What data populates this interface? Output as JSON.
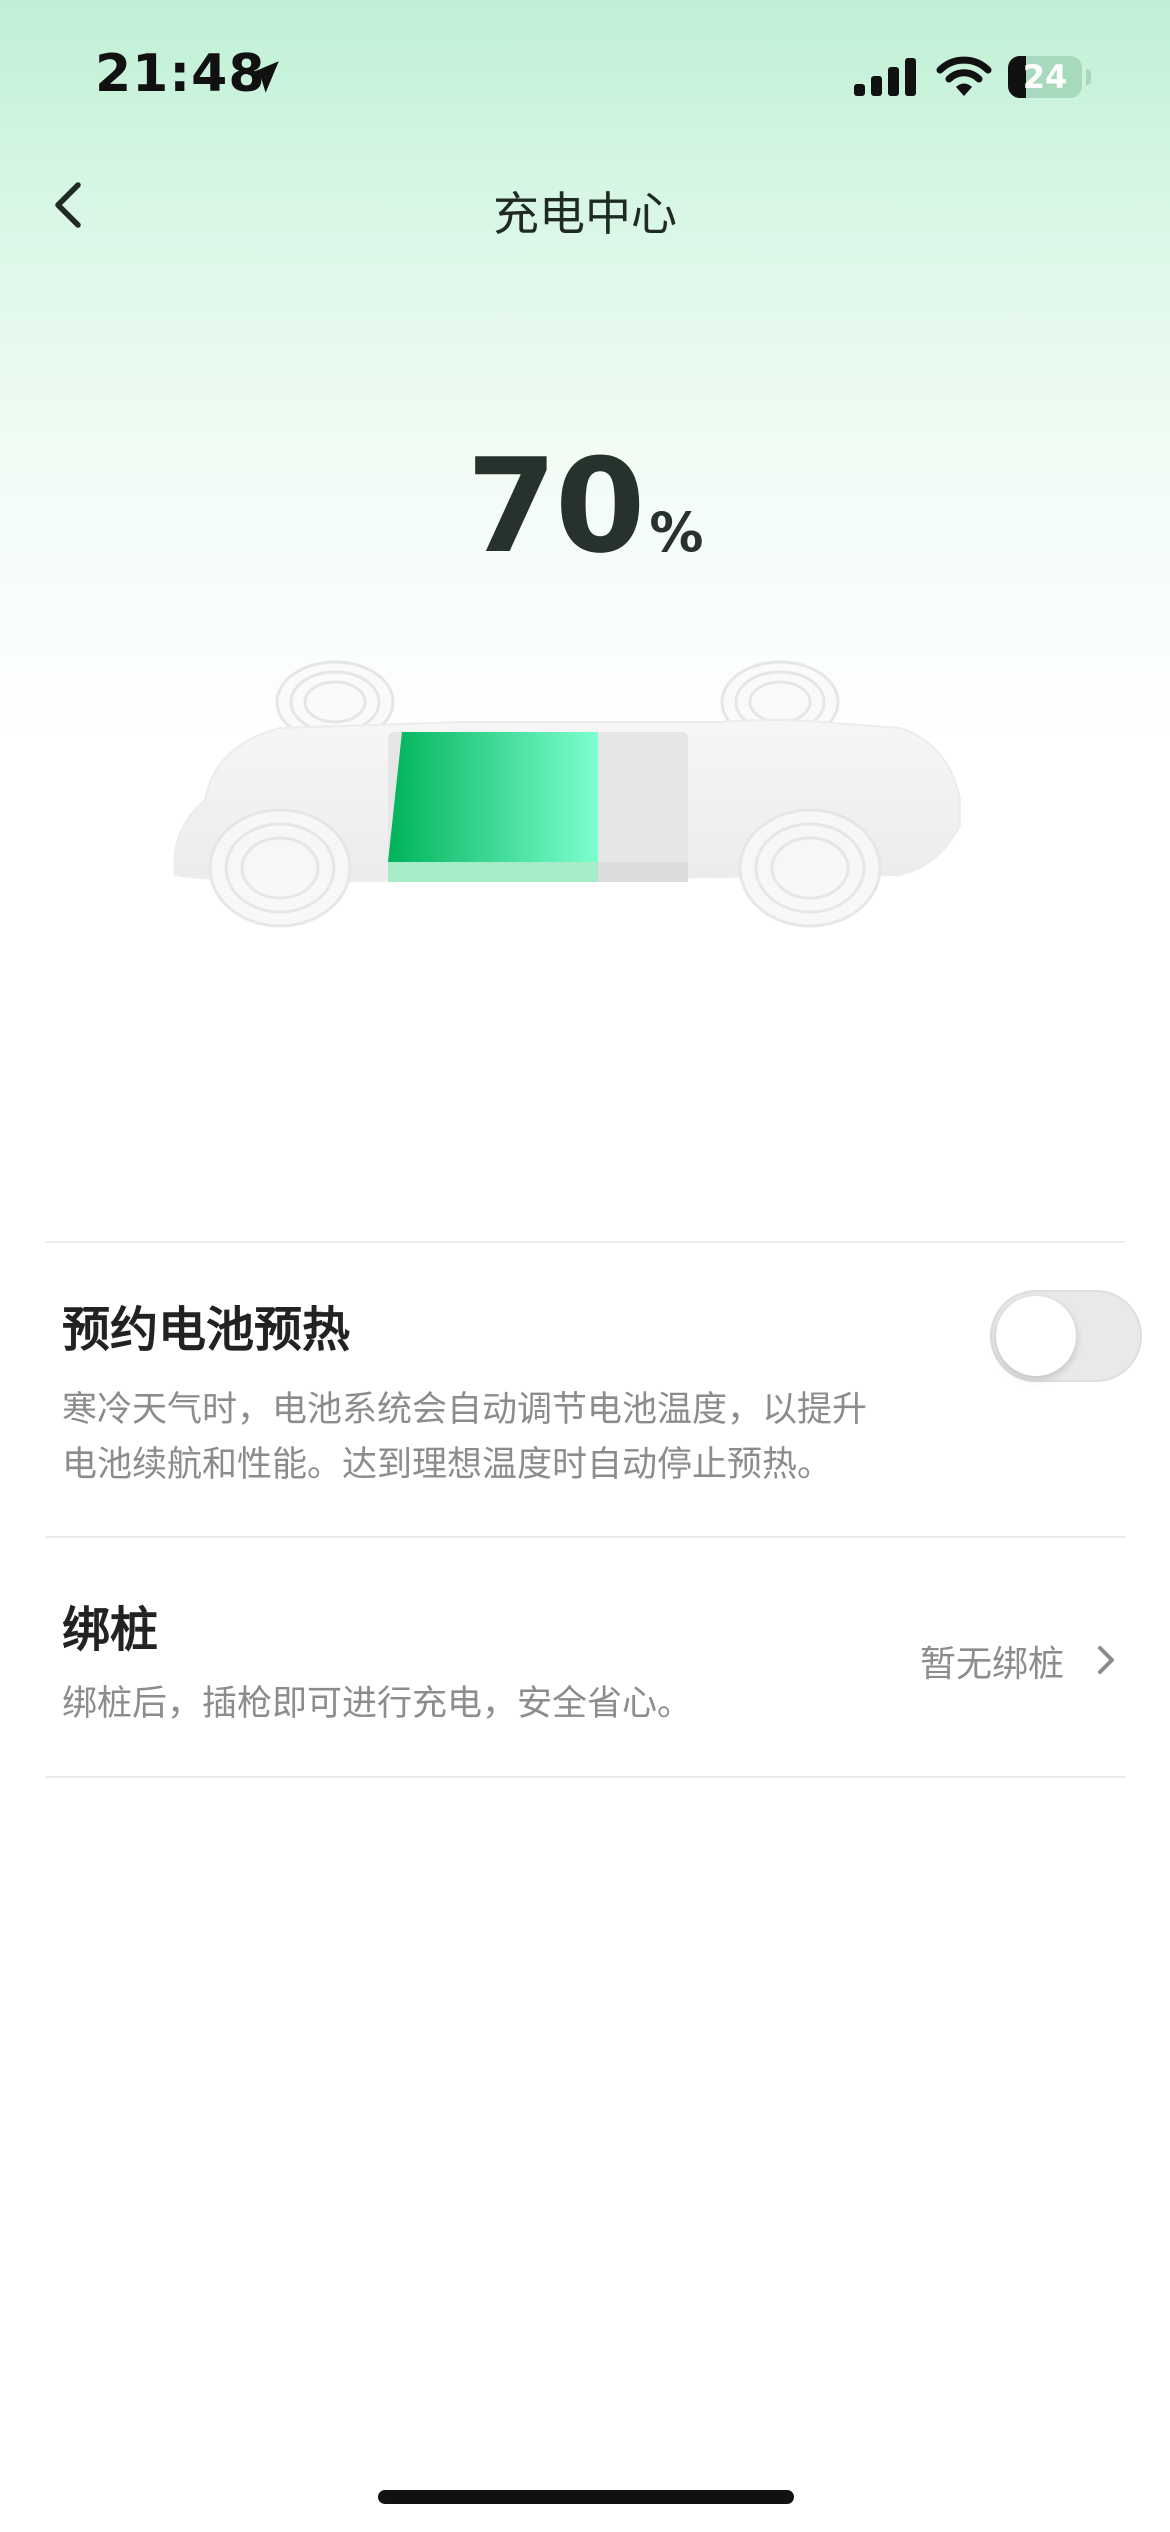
{
  "status_bar": {
    "time": "21:48",
    "battery_level": "24",
    "battery_fraction": 0.24
  },
  "nav": {
    "title": "充电中心",
    "back_icon": "chevron-left-icon"
  },
  "battery": {
    "value": "70",
    "unit": "%",
    "fraction": 0.7,
    "accent_start": "#00b35a",
    "accent_end": "#7dffd0"
  },
  "settings": {
    "preheat": {
      "title": "预约电池预热",
      "description_line1": "寒冷天气时，电池系统会自动调节电池温度，以提升",
      "description_line2": "电池续航和性能。达到理想温度时自动停止预热。",
      "enabled": false
    },
    "bind_pile": {
      "title": "绑桩",
      "description": "绑桩后，插枪即可进行充电，安全省心。",
      "value": "暂无绑桩"
    }
  }
}
